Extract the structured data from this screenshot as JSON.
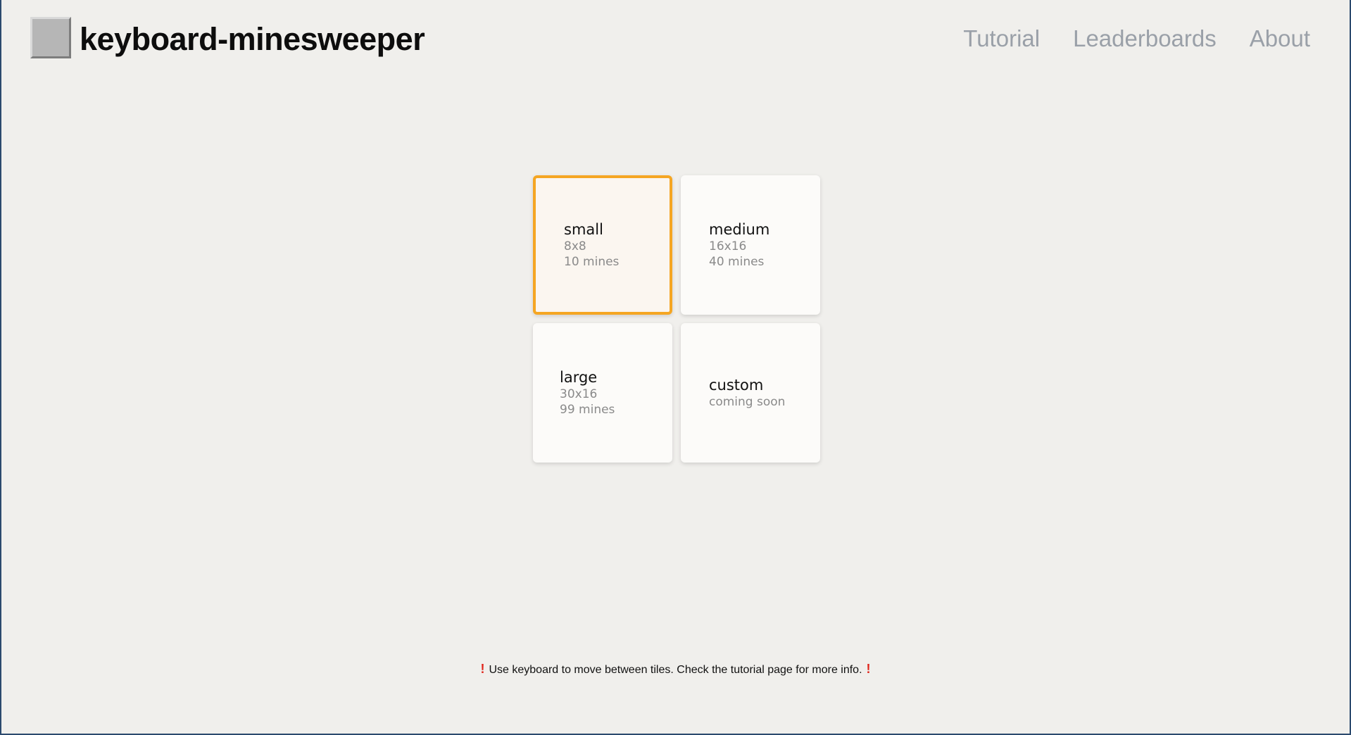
{
  "header": {
    "title": "keyboard-minesweeper",
    "nav": [
      {
        "label": "Tutorial"
      },
      {
        "label": "Leaderboards"
      },
      {
        "label": "About"
      }
    ]
  },
  "tiles": [
    {
      "name": "small",
      "lines": [
        "8x8",
        "10 mines"
      ],
      "selected": true
    },
    {
      "name": "medium",
      "lines": [
        "16x16",
        "40 mines"
      ],
      "selected": false
    },
    {
      "name": "large",
      "lines": [
        "30x16",
        "99 mines"
      ],
      "selected": false
    },
    {
      "name": "custom",
      "lines": [
        "coming soon"
      ],
      "selected": false
    }
  ],
  "footer": {
    "icon": "exclamation-icon",
    "message": "Use keyboard to move between tiles. Check the tutorial page for more info.",
    "icon_color": "#e0251b"
  },
  "colors": {
    "selected_border": "#f5a623",
    "background": "#f0efec"
  }
}
